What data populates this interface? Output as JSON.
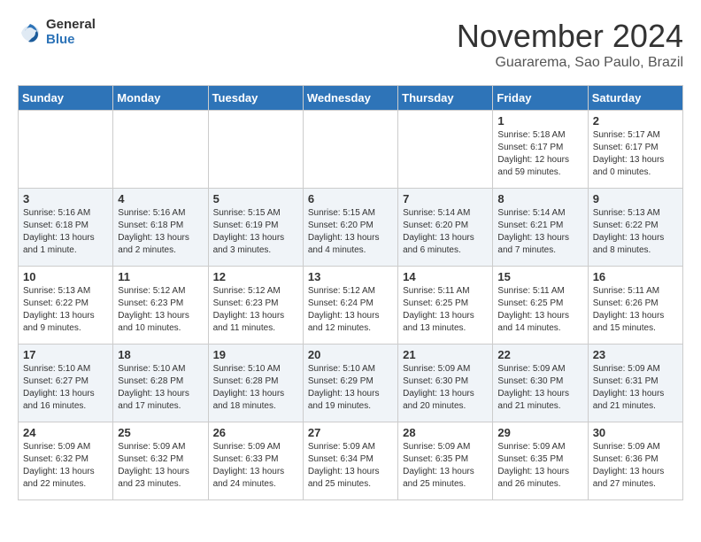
{
  "logo": {
    "general": "General",
    "blue": "Blue"
  },
  "title": "November 2024",
  "location": "Guararema, Sao Paulo, Brazil",
  "days_of_week": [
    "Sunday",
    "Monday",
    "Tuesday",
    "Wednesday",
    "Thursday",
    "Friday",
    "Saturday"
  ],
  "weeks": [
    [
      {
        "day": "",
        "info": ""
      },
      {
        "day": "",
        "info": ""
      },
      {
        "day": "",
        "info": ""
      },
      {
        "day": "",
        "info": ""
      },
      {
        "day": "",
        "info": ""
      },
      {
        "day": "1",
        "info": "Sunrise: 5:18 AM\nSunset: 6:17 PM\nDaylight: 12 hours\nand 59 minutes."
      },
      {
        "day": "2",
        "info": "Sunrise: 5:17 AM\nSunset: 6:17 PM\nDaylight: 13 hours\nand 0 minutes."
      }
    ],
    [
      {
        "day": "3",
        "info": "Sunrise: 5:16 AM\nSunset: 6:18 PM\nDaylight: 13 hours\nand 1 minute."
      },
      {
        "day": "4",
        "info": "Sunrise: 5:16 AM\nSunset: 6:18 PM\nDaylight: 13 hours\nand 2 minutes."
      },
      {
        "day": "5",
        "info": "Sunrise: 5:15 AM\nSunset: 6:19 PM\nDaylight: 13 hours\nand 3 minutes."
      },
      {
        "day": "6",
        "info": "Sunrise: 5:15 AM\nSunset: 6:20 PM\nDaylight: 13 hours\nand 4 minutes."
      },
      {
        "day": "7",
        "info": "Sunrise: 5:14 AM\nSunset: 6:20 PM\nDaylight: 13 hours\nand 6 minutes."
      },
      {
        "day": "8",
        "info": "Sunrise: 5:14 AM\nSunset: 6:21 PM\nDaylight: 13 hours\nand 7 minutes."
      },
      {
        "day": "9",
        "info": "Sunrise: 5:13 AM\nSunset: 6:22 PM\nDaylight: 13 hours\nand 8 minutes."
      }
    ],
    [
      {
        "day": "10",
        "info": "Sunrise: 5:13 AM\nSunset: 6:22 PM\nDaylight: 13 hours\nand 9 minutes."
      },
      {
        "day": "11",
        "info": "Sunrise: 5:12 AM\nSunset: 6:23 PM\nDaylight: 13 hours\nand 10 minutes."
      },
      {
        "day": "12",
        "info": "Sunrise: 5:12 AM\nSunset: 6:23 PM\nDaylight: 13 hours\nand 11 minutes."
      },
      {
        "day": "13",
        "info": "Sunrise: 5:12 AM\nSunset: 6:24 PM\nDaylight: 13 hours\nand 12 minutes."
      },
      {
        "day": "14",
        "info": "Sunrise: 5:11 AM\nSunset: 6:25 PM\nDaylight: 13 hours\nand 13 minutes."
      },
      {
        "day": "15",
        "info": "Sunrise: 5:11 AM\nSunset: 6:25 PM\nDaylight: 13 hours\nand 14 minutes."
      },
      {
        "day": "16",
        "info": "Sunrise: 5:11 AM\nSunset: 6:26 PM\nDaylight: 13 hours\nand 15 minutes."
      }
    ],
    [
      {
        "day": "17",
        "info": "Sunrise: 5:10 AM\nSunset: 6:27 PM\nDaylight: 13 hours\nand 16 minutes."
      },
      {
        "day": "18",
        "info": "Sunrise: 5:10 AM\nSunset: 6:28 PM\nDaylight: 13 hours\nand 17 minutes."
      },
      {
        "day": "19",
        "info": "Sunrise: 5:10 AM\nSunset: 6:28 PM\nDaylight: 13 hours\nand 18 minutes."
      },
      {
        "day": "20",
        "info": "Sunrise: 5:10 AM\nSunset: 6:29 PM\nDaylight: 13 hours\nand 19 minutes."
      },
      {
        "day": "21",
        "info": "Sunrise: 5:09 AM\nSunset: 6:30 PM\nDaylight: 13 hours\nand 20 minutes."
      },
      {
        "day": "22",
        "info": "Sunrise: 5:09 AM\nSunset: 6:30 PM\nDaylight: 13 hours\nand 21 minutes."
      },
      {
        "day": "23",
        "info": "Sunrise: 5:09 AM\nSunset: 6:31 PM\nDaylight: 13 hours\nand 21 minutes."
      }
    ],
    [
      {
        "day": "24",
        "info": "Sunrise: 5:09 AM\nSunset: 6:32 PM\nDaylight: 13 hours\nand 22 minutes."
      },
      {
        "day": "25",
        "info": "Sunrise: 5:09 AM\nSunset: 6:32 PM\nDaylight: 13 hours\nand 23 minutes."
      },
      {
        "day": "26",
        "info": "Sunrise: 5:09 AM\nSunset: 6:33 PM\nDaylight: 13 hours\nand 24 minutes."
      },
      {
        "day": "27",
        "info": "Sunrise: 5:09 AM\nSunset: 6:34 PM\nDaylight: 13 hours\nand 25 minutes."
      },
      {
        "day": "28",
        "info": "Sunrise: 5:09 AM\nSunset: 6:35 PM\nDaylight: 13 hours\nand 25 minutes."
      },
      {
        "day": "29",
        "info": "Sunrise: 5:09 AM\nSunset: 6:35 PM\nDaylight: 13 hours\nand 26 minutes."
      },
      {
        "day": "30",
        "info": "Sunrise: 5:09 AM\nSunset: 6:36 PM\nDaylight: 13 hours\nand 27 minutes."
      }
    ]
  ]
}
